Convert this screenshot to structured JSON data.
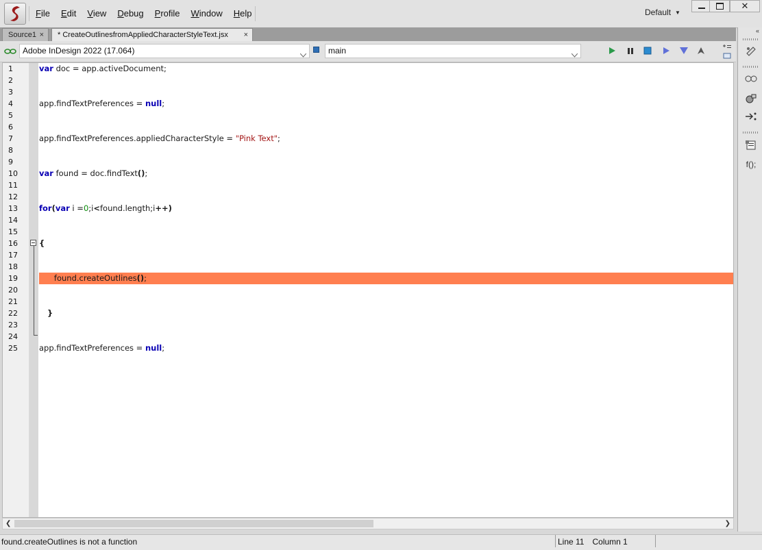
{
  "menubar": {
    "items": [
      "File",
      "Edit",
      "View",
      "Debug",
      "Profile",
      "Window",
      "Help"
    ],
    "workspace": "Default",
    "window_controls": [
      "minimize-icon",
      "maximize-icon",
      "close-icon"
    ]
  },
  "tabs": [
    {
      "label": "Source1",
      "close": "×",
      "active": false
    },
    {
      "label": "* CreateOutlinesfromAppliedCharacterStyleText.jsx",
      "close": "×",
      "active": true
    }
  ],
  "target": {
    "application": "Adobe InDesign 2022 (17.064)",
    "engine": "main",
    "buttons": [
      "run-icon",
      "pause-icon",
      "stop-icon",
      "step-over-icon",
      "step-into-icon",
      "step-out-icon"
    ]
  },
  "editor": {
    "line_numbers": [
      "1",
      "2",
      "3",
      "4",
      "5",
      "6",
      "7",
      "8",
      "9",
      "10",
      "11",
      "12",
      "13",
      "14",
      "15",
      "16",
      "17",
      "18",
      "19",
      "20",
      "21",
      "22",
      "23",
      "24",
      "25"
    ],
    "highlighted_line": 19,
    "highlight_color": "#ff7f50",
    "lines": {
      "l1": {
        "kw": "var",
        "rest": " doc = app.activeDocument;"
      },
      "l4": {
        "text": "app.findTextPreferences = ",
        "kw": "null",
        "end": ";"
      },
      "l7": {
        "text": "app.findTextPreferences.appliedCharacterStyle = ",
        "str": "\"Pink Text\"",
        "end": ";"
      },
      "l10": {
        "kw": "var",
        "rest": " found = doc.findText",
        "paren": "()",
        "end": ";"
      },
      "l13": {
        "kw1": "for",
        "p1": "(",
        "kw2": "var",
        "mid": " i =",
        "num": "0",
        "rest": ";i",
        "op": "<",
        "rest2": "found.length;i",
        "inc": "++",
        "p2": ")"
      },
      "l16": {
        "text": "{"
      },
      "l19": {
        "text": "      found.createOutlines",
        "paren": "()",
        "end": ";"
      },
      "l22": {
        "text": "   }"
      },
      "l25": {
        "text": "app.findTextPreferences = ",
        "kw": "null",
        "end": ";"
      }
    }
  },
  "right_panel": {
    "icons": [
      "breakpoint-icon",
      "data-browser-icon",
      "call-stack-icon",
      "step-icon",
      "script-icon",
      "functions-icon"
    ],
    "functions_label": "f();"
  },
  "statusbar": {
    "message": "found.createOutlines is not a function",
    "line": "Line 11",
    "column": "Column 1"
  },
  "colors": {
    "keyword": "#0a00b4",
    "string": "#a31515",
    "number": "#0a8a0a",
    "highlight": "#ff7f50"
  }
}
